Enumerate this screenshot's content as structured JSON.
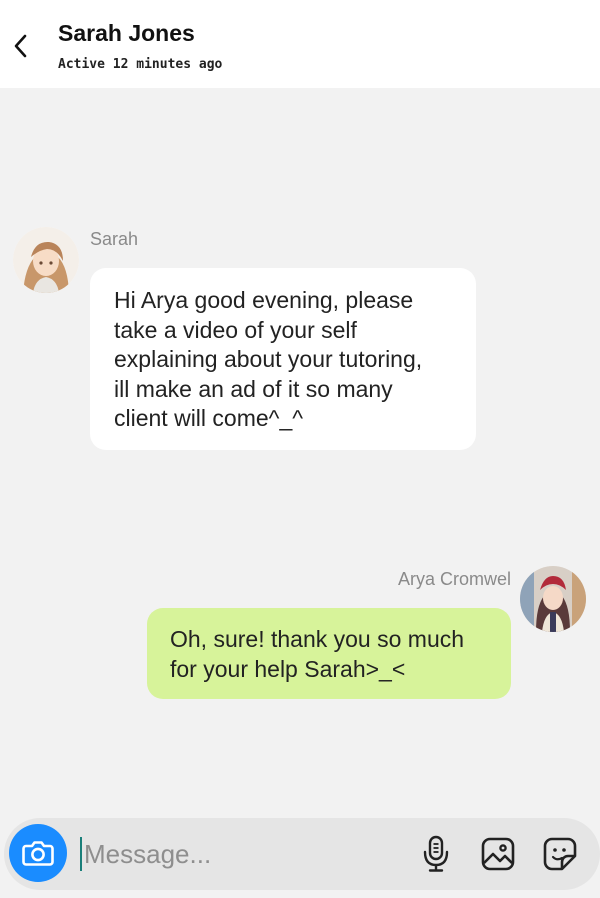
{
  "header": {
    "contact_name": "Sarah Jones",
    "status": "Active 12 minutes ago"
  },
  "messages": [
    {
      "sender": "Sarah",
      "direction": "incoming",
      "text": "Hi Arya good evening, please\ntake a video of your self\nexplaining about your tutoring,\nill make an ad of it so many\nclient will come^_^"
    },
    {
      "sender": "Arya Cromwel",
      "direction": "outgoing",
      "text": "Oh, sure! thank you so much\nfor your help Sarah>_<"
    }
  ],
  "composer": {
    "placeholder": "Message...",
    "value": ""
  },
  "colors": {
    "background": "#f2f2f2",
    "incoming_bubble": "#ffffff",
    "outgoing_bubble": "#d7f39a",
    "camera_button": "#1a8cff"
  },
  "icons": [
    "back-arrow-icon",
    "camera-icon",
    "microphone-icon",
    "gallery-icon",
    "sticker-icon"
  ]
}
